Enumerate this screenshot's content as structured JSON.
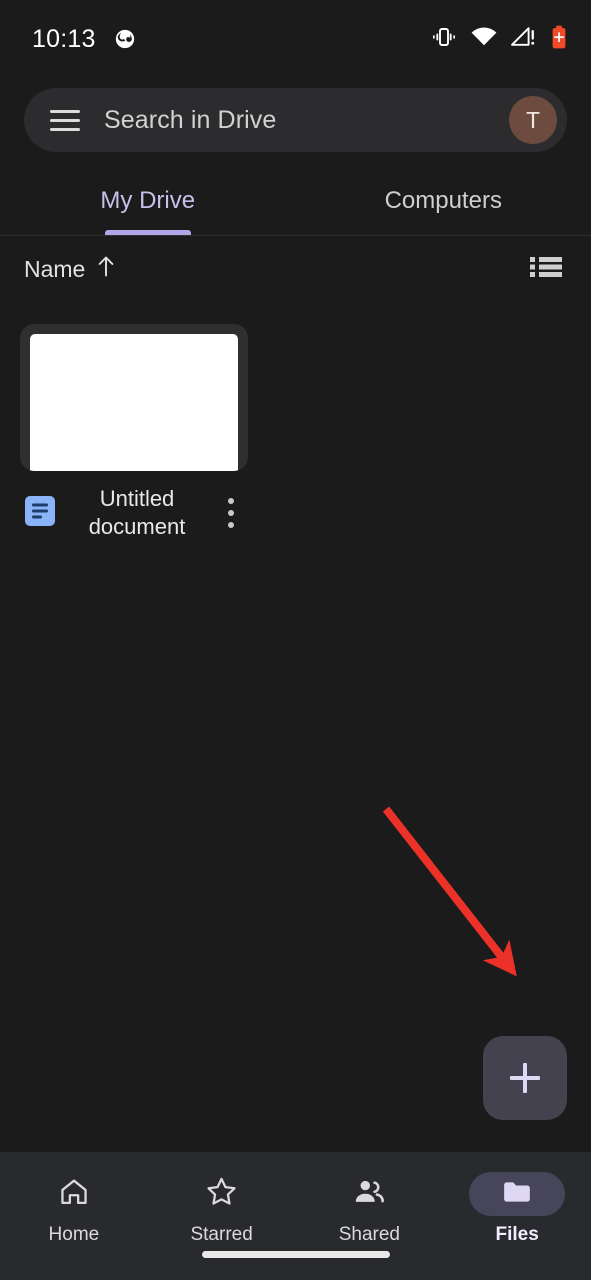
{
  "status_bar": {
    "time": "10:13",
    "icons": [
      "spiral-notification-icon",
      "vibrate-icon",
      "wifi-icon",
      "cellular-signal-warning-icon",
      "battery-charging-icon"
    ],
    "battery_color": "#f04a28"
  },
  "search": {
    "menu_icon": "hamburger-menu-icon",
    "placeholder": "Search in Drive",
    "avatar_initial": "T",
    "avatar_color": "#6d4c3f",
    "bar_color": "#2c2c2e"
  },
  "tabs": [
    {
      "label": "My Drive",
      "active": true
    },
    {
      "label": "Computers",
      "active": false
    }
  ],
  "tab_accent": "#b3a6e8",
  "sort": {
    "label": "Name",
    "direction_icon": "arrow-up-icon",
    "view_toggle_icon": "list-view-icon"
  },
  "files": [
    {
      "name": "Untitled document",
      "type_icon": "google-docs-icon",
      "icon_color": "#8ab4f8",
      "menu_icon": "kebab-menu-icon",
      "thumbnail": "blank-white-page"
    }
  ],
  "fab": {
    "label": "+",
    "name": "new-button",
    "background": "#45424f",
    "icon_color": "#ded8f5"
  },
  "annotation": {
    "type": "arrow",
    "color": "#ec3228",
    "points_to": "new-button"
  },
  "bottom_nav": [
    {
      "label": "Home",
      "icon": "home-icon",
      "active": false
    },
    {
      "label": "Starred",
      "icon": "star-outline-icon",
      "active": false
    },
    {
      "label": "Shared",
      "icon": "people-icon",
      "active": false
    },
    {
      "label": "Files",
      "icon": "folder-icon",
      "active": true
    }
  ],
  "nav_active_pill": "#474559",
  "background": "#1b1b1b",
  "nav_background": "#292a2e"
}
